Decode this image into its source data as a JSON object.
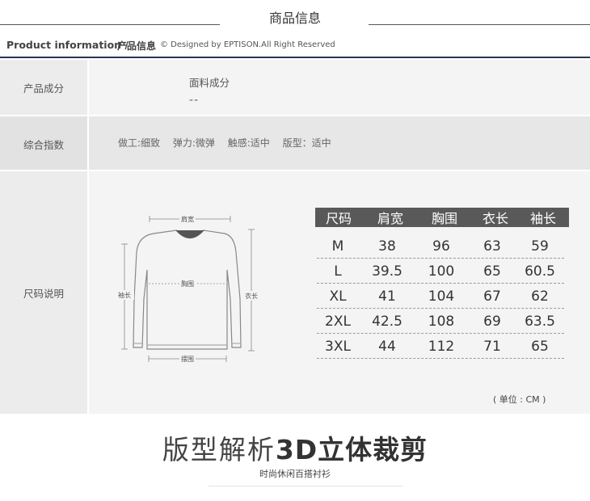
{
  "header": {
    "title": "商品信息",
    "subtitle_en": "Product information /",
    "subtitle_cn": "产品信息",
    "credit": "© Designed by EPTISON.All Right Reserved"
  },
  "rows": {
    "fabric": {
      "label": "产品成分",
      "title": "面料成分",
      "value": "--"
    },
    "index": {
      "label": "综合指数",
      "items": [
        "做工:细致",
        "弹力:微弹",
        "触感:适中",
        "版型：适中"
      ]
    },
    "size": {
      "label": "尺码说明"
    }
  },
  "diagram": {
    "shoulder": "肩宽",
    "chest": "胸围",
    "sleeve": "袖长",
    "length": "衣长",
    "hem": "摆围"
  },
  "size_table": {
    "headers": [
      "尺码",
      "肩宽",
      "胸围",
      "衣长",
      "袖长"
    ],
    "rows": [
      [
        "M",
        "38",
        "96",
        "63",
        "59"
      ],
      [
        "L",
        "39.5",
        "100",
        "65",
        "60.5"
      ],
      [
        "XL",
        "41",
        "104",
        "67",
        "62"
      ],
      [
        "2XL",
        "42.5",
        "108",
        "69",
        "63.5"
      ],
      [
        "3XL",
        "44",
        "112",
        "71",
        "65"
      ]
    ],
    "unit": "( 单位 : CM )"
  },
  "footer": {
    "title_light": "版型解析",
    "title_bold": "3D立体裁剪",
    "subtitle": "时尚休闲百搭衬衫"
  },
  "colors": {
    "table_header_bg": "#595959",
    "navy_rule": "#2c3450",
    "label_bg": "#ececec"
  }
}
